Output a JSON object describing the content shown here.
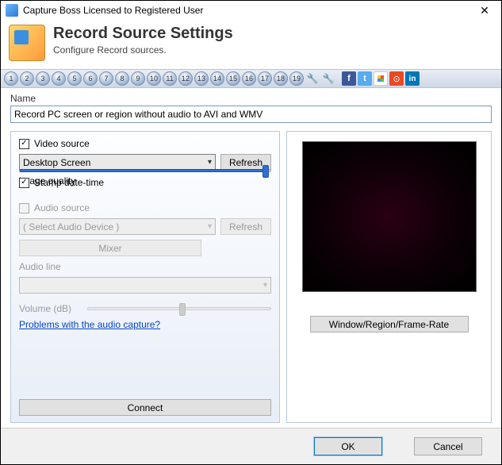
{
  "window": {
    "title": "Capture Boss Licensed to Registered User"
  },
  "header": {
    "title": "Record Source Settings",
    "subtitle": "Configure Record sources."
  },
  "toolbar": {
    "presets": [
      "1",
      "2",
      "3",
      "4",
      "5",
      "6",
      "7",
      "8",
      "9",
      "10",
      "11",
      "12",
      "13",
      "14",
      "15",
      "16",
      "17",
      "18",
      "19"
    ]
  },
  "name": {
    "label": "Name",
    "value": "Record PC screen or region without audio to AVI and WMV"
  },
  "video": {
    "source_label": "Video source",
    "source_checked": true,
    "device": "Desktop Screen",
    "refresh": "Refresh",
    "image_quality_label": "Image quality",
    "stamp_label": "Stamp date-time",
    "stamp_checked": true
  },
  "audio": {
    "source_label": "Audio source",
    "device_placeholder": "( Select Audio Device )",
    "refresh": "Refresh",
    "mixer": "Mixer",
    "line_label": "Audio line",
    "volume_label": "Volume (dB)",
    "problems_link": "Problems with the audio capture?"
  },
  "connect": "Connect",
  "preview": {
    "button": "Window/Region/Frame-Rate"
  },
  "footer": {
    "ok": "OK",
    "cancel": "Cancel"
  }
}
